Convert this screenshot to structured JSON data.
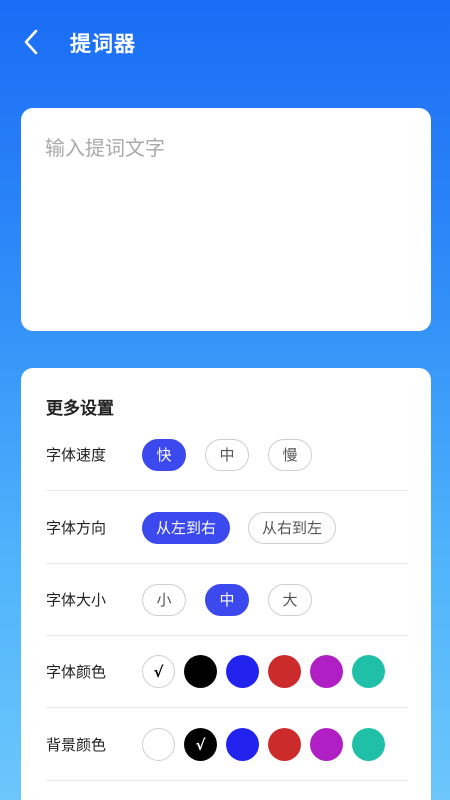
{
  "header": {
    "title": "提词器",
    "back_icon": "chevron-left-icon"
  },
  "input": {
    "placeholder": "输入提词文字",
    "value": ""
  },
  "settings": {
    "title": "更多设置",
    "speed": {
      "label": "字体速度",
      "options": [
        "快",
        "中",
        "慢"
      ],
      "selected": "快"
    },
    "direction": {
      "label": "字体方向",
      "options": [
        "从左到右",
        "从右到左"
      ],
      "selected": "从左到右"
    },
    "size": {
      "label": "字体大小",
      "options": [
        "小",
        "中",
        "大"
      ],
      "selected": "中"
    },
    "font_color": {
      "label": "字体颜色",
      "colors": [
        "#ffffff",
        "#000000",
        "#2323f0",
        "#cc2b2b",
        "#b01fc4",
        "#1fbfa8"
      ],
      "selected_index": 0
    },
    "bg_color": {
      "label": "背景颜色",
      "colors": [
        "#ffffff",
        "#000000",
        "#2323f0",
        "#cc2b2b",
        "#b01fc4",
        "#1fbfa8"
      ],
      "selected_index": 1
    },
    "check_mark": "√"
  },
  "colors": {
    "accent": "#3b49ee",
    "header_bg": "#1a6cf5"
  }
}
